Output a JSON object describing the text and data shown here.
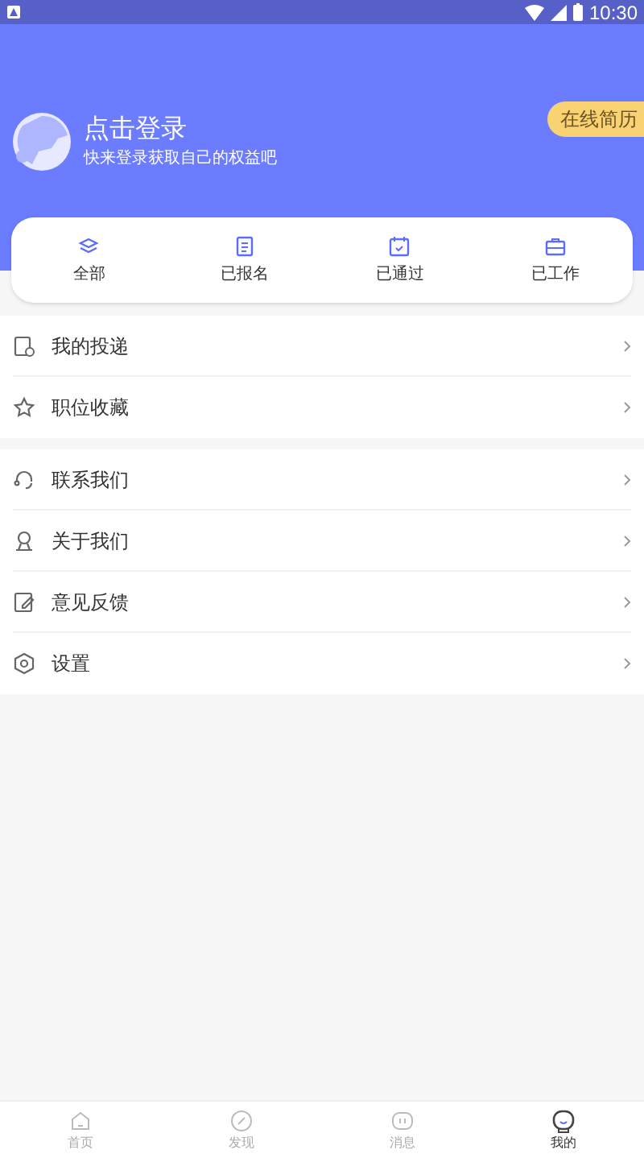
{
  "status_bar": {
    "time": "10:30"
  },
  "profile": {
    "title": "点击登录",
    "subtitle": "快来登录获取自己的权益吧",
    "resume_button": "在线简历"
  },
  "shortcuts": [
    {
      "label": "全部"
    },
    {
      "label": "已报名"
    },
    {
      "label": "已通过"
    },
    {
      "label": "已工作"
    }
  ],
  "menu_groups": [
    [
      {
        "label": "我的投递"
      },
      {
        "label": "职位收藏"
      }
    ],
    [
      {
        "label": "联系我们"
      },
      {
        "label": "关于我们"
      },
      {
        "label": "意见反馈"
      },
      {
        "label": "设置"
      }
    ]
  ],
  "bottom_nav": [
    {
      "label": "首页",
      "selected": false
    },
    {
      "label": "发现",
      "selected": false
    },
    {
      "label": "消息",
      "selected": false
    },
    {
      "label": "我的",
      "selected": true
    }
  ]
}
